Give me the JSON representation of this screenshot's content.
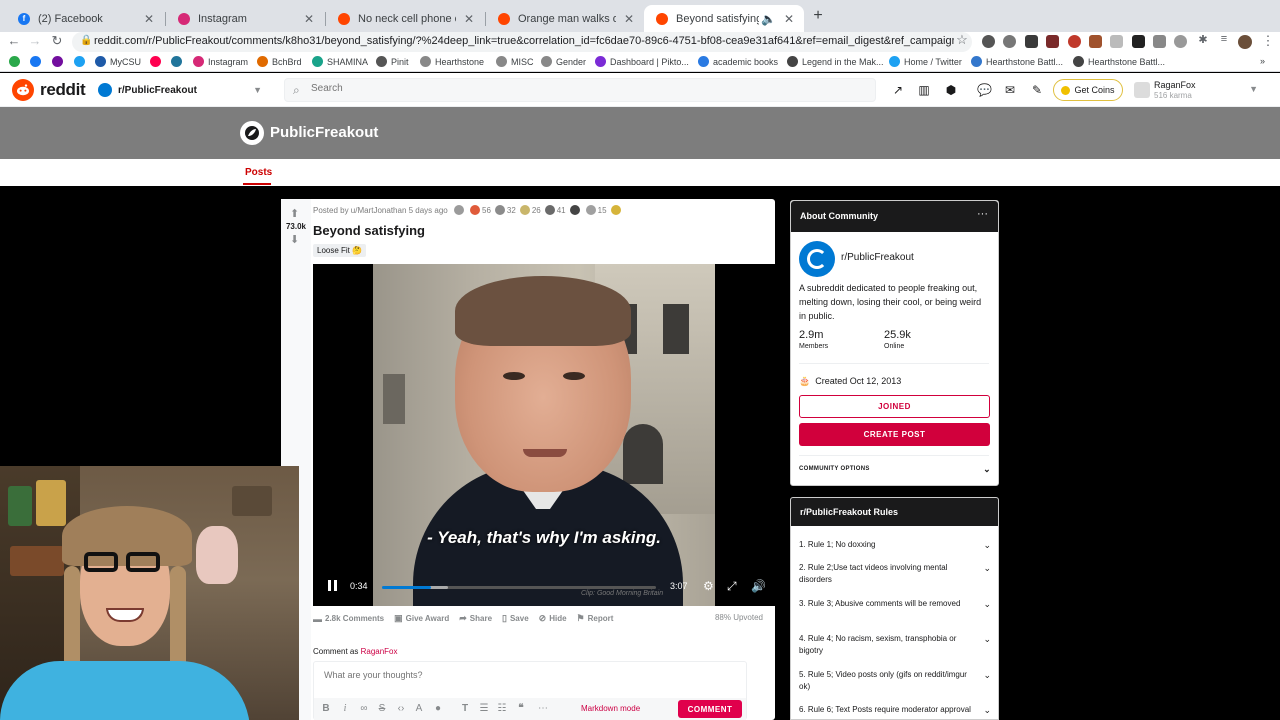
{
  "browser": {
    "tabs": [
      {
        "title": "(2) Facebook",
        "active": false,
        "color": "#1877f2"
      },
      {
        "title": "Instagram",
        "active": false,
        "color": "#d62976"
      },
      {
        "title": "No neck cell phone customer",
        "active": false,
        "color": "#ff4500"
      },
      {
        "title": "Orange man walks out of medi",
        "active": false,
        "color": "#ff4500"
      },
      {
        "title": "Beyond satisfying : Public",
        "active": true,
        "color": "#ff4500"
      }
    ],
    "url": "reddit.com/r/PublicFreakout/comments/k8ho31/beyond_satisfying/?%24deep_link=true&correlation_id=fc6dae70-89c6-4751-bf08-cea9e31af641&ref=email_digest&ref_campaign=email_dige...",
    "bookmarks": [
      {
        "label": "",
        "color": "#2aa84a"
      },
      {
        "label": "",
        "color": "#1877f2"
      },
      {
        "label": "",
        "color": "#720e9e"
      },
      {
        "label": "",
        "color": "#1da1f2"
      },
      {
        "label": "MyCSU",
        "color": "#1e5aa8"
      },
      {
        "label": "",
        "color": "#ff0050"
      },
      {
        "label": "",
        "color": "#21759b"
      },
      {
        "label": "Instagram",
        "color": "#d62976"
      },
      {
        "label": "BchBrd",
        "color": "#e06a00"
      },
      {
        "label": "SHAMINA",
        "color": "#19a38a"
      },
      {
        "label": "Pinit",
        "color": "#555555"
      },
      {
        "label": "Hearthstone",
        "color": "#888888"
      },
      {
        "label": "MISC",
        "color": "#888888"
      },
      {
        "label": "Gender",
        "color": "#888888"
      },
      {
        "label": "Dashboard | Pikto...",
        "color": "#7b2bd6"
      },
      {
        "label": "academic books",
        "color": "#2a7ae2"
      },
      {
        "label": "Legend in the Mak...",
        "color": "#444444"
      },
      {
        "label": "Home / Twitter",
        "color": "#1da1f2"
      },
      {
        "label": "Hearthstone Battl...",
        "color": "#3377cc"
      },
      {
        "label": "Hearthstone Battl...",
        "color": "#444444"
      }
    ]
  },
  "reddit": {
    "logo_text": "reddit",
    "community": "r/PublicFreakout",
    "search_placeholder": "Search",
    "coins_label": "Get Coins",
    "username": "RaganFox",
    "karma": "516 karma",
    "banner_name": "PublicFreakout",
    "nav_posts": "Posts"
  },
  "post": {
    "score": "73.0k",
    "meta": "Posted by u/MartJonathan 5 days ago",
    "awards": [
      {
        "count": "",
        "color": "#9b9b9b"
      },
      {
        "count": "56",
        "color": "#e05b3a"
      },
      {
        "count": "32",
        "color": "#8b8b8b"
      },
      {
        "count": "26",
        "color": "#c9b66b"
      },
      {
        "count": "41",
        "color": "#6a6a6a"
      },
      {
        "count": "",
        "color": "#444444"
      },
      {
        "count": "15",
        "color": "#a0a0a0"
      },
      {
        "count": "",
        "color": "#d6b43a"
      }
    ],
    "title": "Beyond satisfying",
    "flair": "Loose Fit 🤔",
    "video": {
      "subtitle": "- Yeah, that's why I'm asking.",
      "credit": "Clip: Good Morning Britain",
      "current_time": "0:34",
      "duration": "3:07",
      "progress": 0.18,
      "buffered": 0.24
    },
    "actions": {
      "comments": "2.8k Comments",
      "award": "Give Award",
      "share": "Share",
      "save": "Save",
      "hide": "Hide",
      "report": "Report"
    },
    "upvoted": "88% Upvoted",
    "comment_as_prefix": "Comment as",
    "comment_as_user": "RaganFox",
    "comment_placeholder": "What are your thoughts?",
    "markdown_mode": "Markdown mode",
    "comment_button": "COMMENT"
  },
  "about": {
    "heading": "About Community",
    "name": "r/PublicFreakout",
    "description": "A subreddit dedicated to people freaking out, melting down, losing their cool, or being weird in public.",
    "members_value": "2.9m",
    "members_label": "Members",
    "online_value": "25.9k",
    "online_label": "Online",
    "created": "Created Oct 12, 2013",
    "joined_button": "JOINED",
    "create_post_button": "CREATE POST",
    "options": "COMMUNITY OPTIONS"
  },
  "rules": {
    "heading": "r/PublicFreakout Rules",
    "items": [
      "1. Rule 1; No doxxing",
      "2. Rule 2;Use tact videos involving mental disorders",
      "3. Rule 3; Abusive comments will be removed",
      "4. Rule 4; No racism, sexism, transphobia or bigotry",
      "5. Rule 5; Video posts only (gifs on reddit/imgur ok)",
      "6. Rule 6; Text Posts require moderator approval"
    ]
  },
  "colors": {
    "reddit_orange": "#ff4500",
    "brand_red": "#d1003c",
    "blue": "#0079d3"
  }
}
